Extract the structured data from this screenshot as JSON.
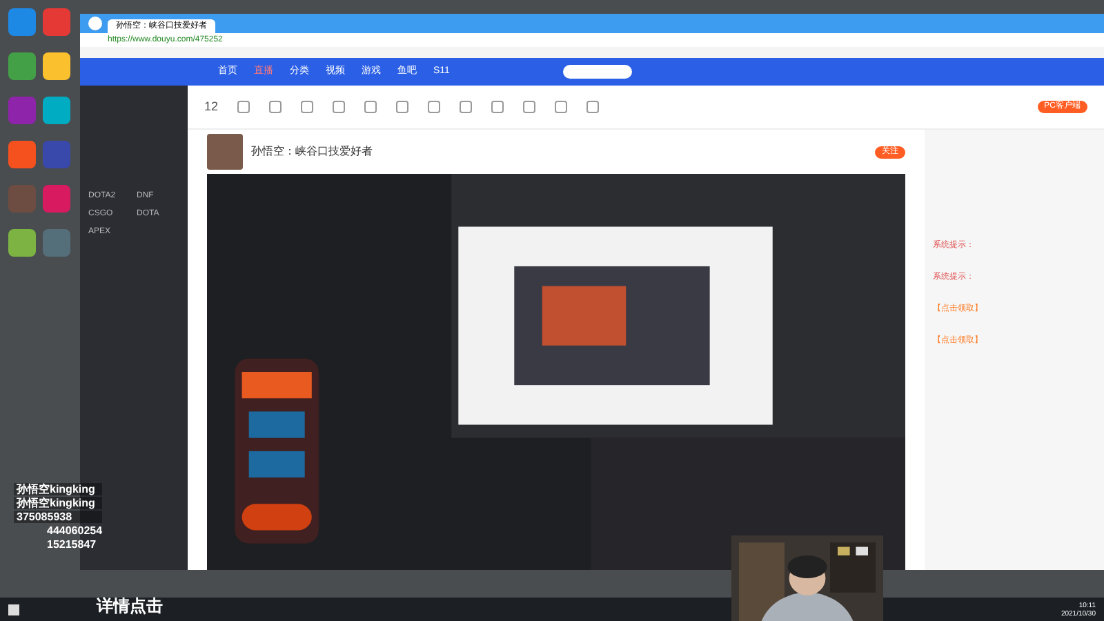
{
  "browser": {
    "tab_title": "孙悟空：峡谷口技爱好者",
    "url": "https://www.douyu.com/475252"
  },
  "site_nav": [
    {
      "label": "首页",
      "selected": false
    },
    {
      "label": "直播",
      "selected": true
    },
    {
      "label": "分类",
      "selected": false
    },
    {
      "label": "视频",
      "selected": false
    },
    {
      "label": "游戏",
      "selected": false
    },
    {
      "label": "鱼吧",
      "selected": false
    },
    {
      "label": "S11",
      "selected": false
    }
  ],
  "toolbar": {
    "count": "12",
    "download_button": "PC客户端"
  },
  "sidebar": {
    "sections": [
      {
        "games": [
          "DOTA2",
          "DNF",
          "CSGO",
          "DOTA",
          "APEX"
        ]
      }
    ]
  },
  "stream": {
    "title": "孙悟空：峡谷口技爱好者",
    "follow_button": "关注"
  },
  "chat": {
    "messages": [
      {
        "kind": "system",
        "label": "系统提示："
      },
      {
        "kind": "system",
        "label": "系统提示："
      },
      {
        "kind": "link",
        "label": "【点击领取】"
      },
      {
        "kind": "link",
        "label": "【点击领取】"
      }
    ]
  },
  "overlay": {
    "socials": [
      "孙悟空kingking",
      "孙悟空kingking",
      "375085938"
    ],
    "groups": [
      "444060254",
      "15215847"
    ],
    "caption": "详情点击"
  },
  "taskbar": {
    "time": "10:11",
    "date": "2021/10/30"
  }
}
